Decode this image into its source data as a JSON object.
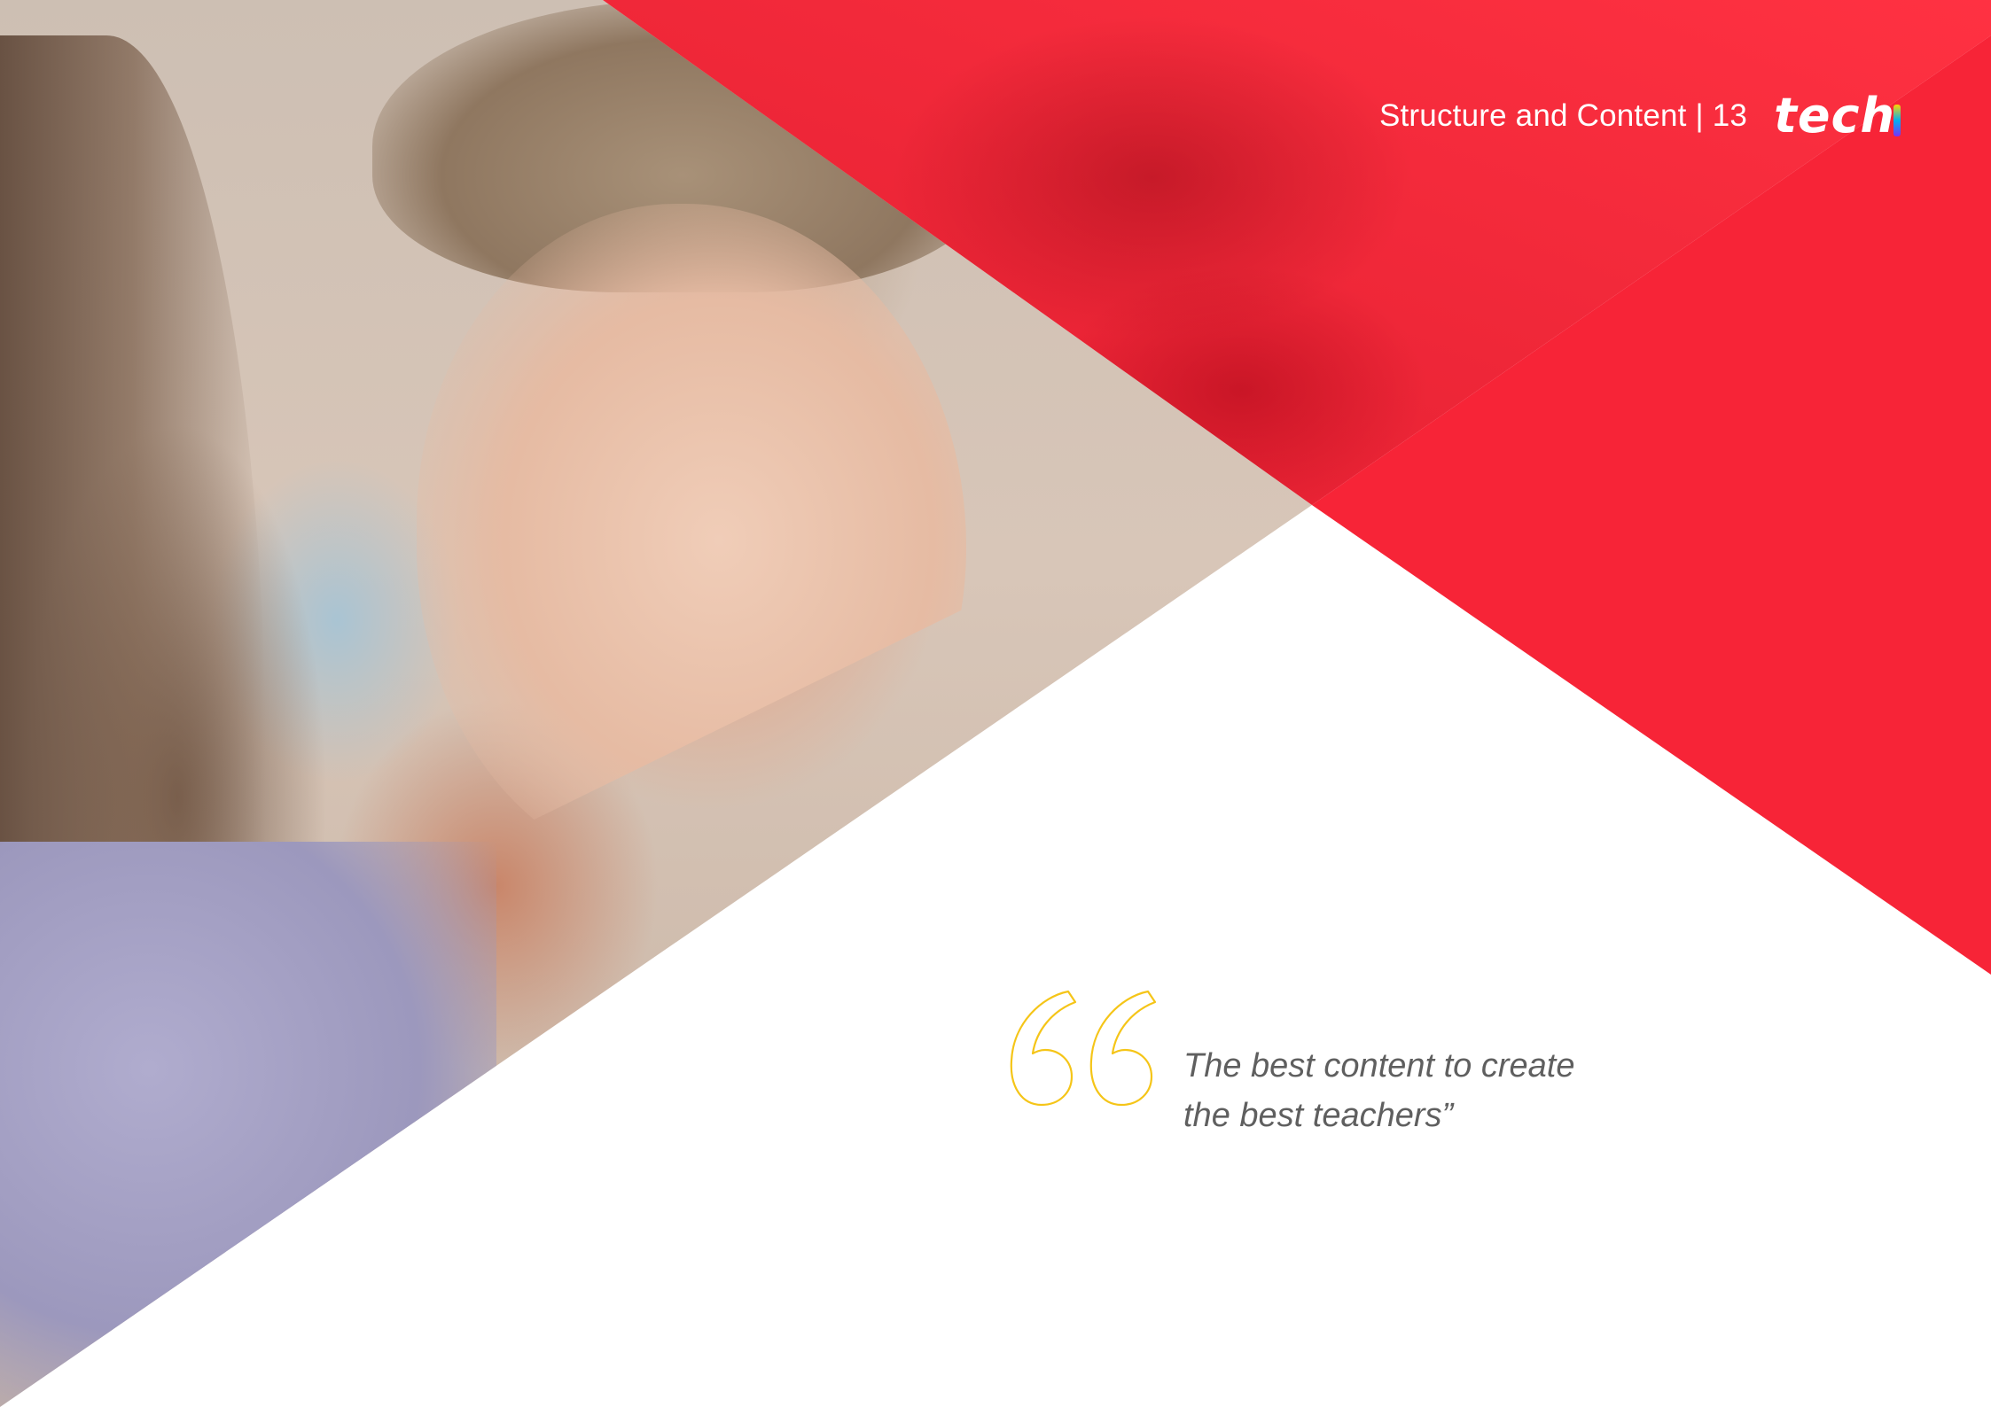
{
  "header": {
    "section_title": "Structure and Content",
    "separator": "|",
    "page_number": "13",
    "logo_text": "tech"
  },
  "quote": {
    "icon": "open-quote-icon",
    "line1": "The best content to create",
    "line2": "the best teachers”",
    "icon_color": "#f5c518"
  },
  "colors": {
    "accent_red": "#f72437",
    "text_gray": "#5f5f5f",
    "background": "#ffffff"
  }
}
